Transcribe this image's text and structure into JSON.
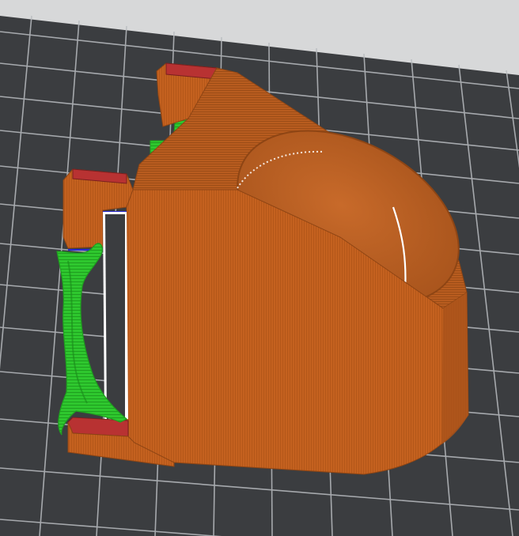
{
  "scene": {
    "view": "3d-slicer-preview",
    "background_color": "#3b3d40",
    "upper_background_color": "#d7d8d9",
    "grid_line_color": "#b9bcc0",
    "model": {
      "name_icon": "printed-part-model",
      "body_color": "#c4611f",
      "body_shadow_color": "#a9531a",
      "top_face_color": "#b85c1f",
      "cup_inner_color": "#bd6324",
      "bridge_color": "#b83232",
      "support_color": "#2ec72e",
      "support_dark_color": "#1f9e1f",
      "highlight_color": "#ffffff"
    }
  }
}
